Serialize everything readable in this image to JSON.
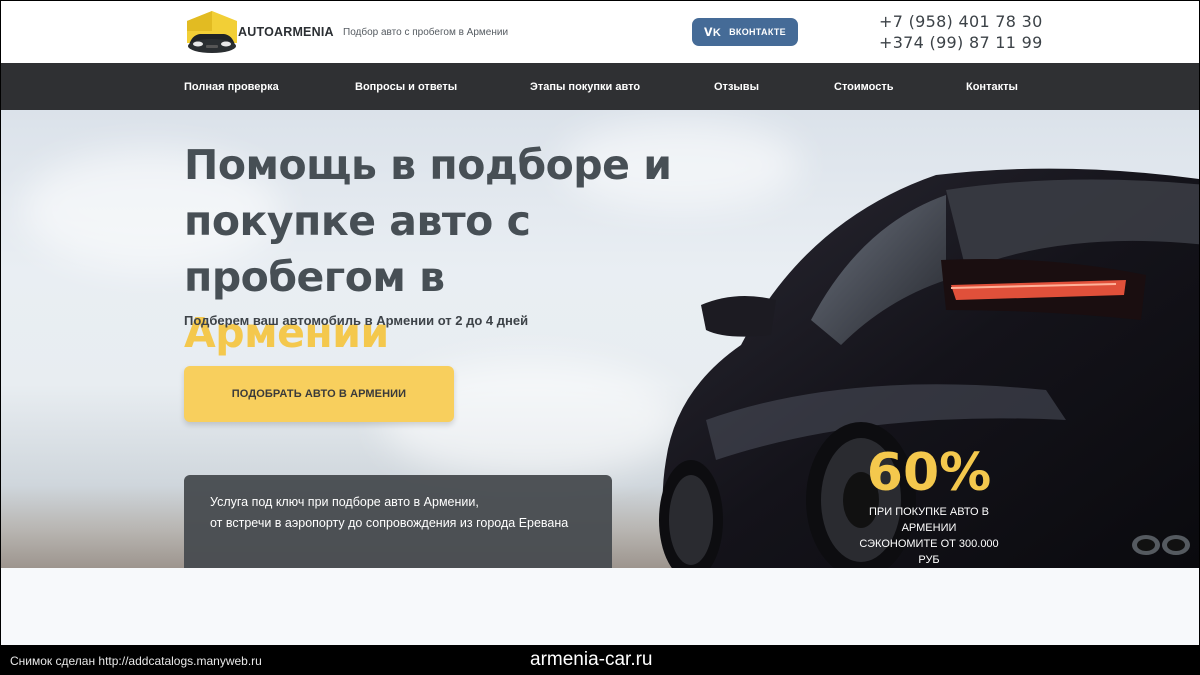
{
  "header": {
    "logo_text": "AUTOARMENIA",
    "tagline": "Подбор авто с пробегом в Армении",
    "vk_label": "ВКОНТАКТЕ",
    "vk_icon": "vk-icon",
    "phones": [
      "+7 (958) 401 78 30",
      "+374 (99) 87 11 99"
    ]
  },
  "nav": {
    "items": [
      "Полная проверка",
      "Вопросы и ответы",
      "Этапы покупки авто",
      "Отзывы",
      "Стоимость",
      "Контакты"
    ]
  },
  "hero": {
    "title_line1": "Помощь в подборе и",
    "title_line2": "покупке авто с пробегом в",
    "title_accent": "Армении",
    "subtitle": "Подберем ваш автомобиль в Армении от 2 до 4 дней",
    "cta_label": "ПОДОБРАТЬ АВТО В АРМЕНИИ",
    "info_lines": [
      "Услуга под ключ при подборе авто в Армении,",
      "от встречи в аэропорту до сопровождения из города Еревана"
    ],
    "promo_value": "60%",
    "promo_lines": [
      "ПРИ ПОКУПКЕ АВТО В АРМЕНИИ",
      "СЭКОНОМИТЕ ОТ 300.000 РУБ"
    ]
  },
  "footer_caption": {
    "left": "Снимок сделан http://addcatalogs.manyweb.ru",
    "center": "armenia-car.ru"
  },
  "colors": {
    "accent": "#f4c84d",
    "nav_bg": "#2f3033",
    "vk": "#456b97",
    "cta": "#f8cf5d"
  }
}
